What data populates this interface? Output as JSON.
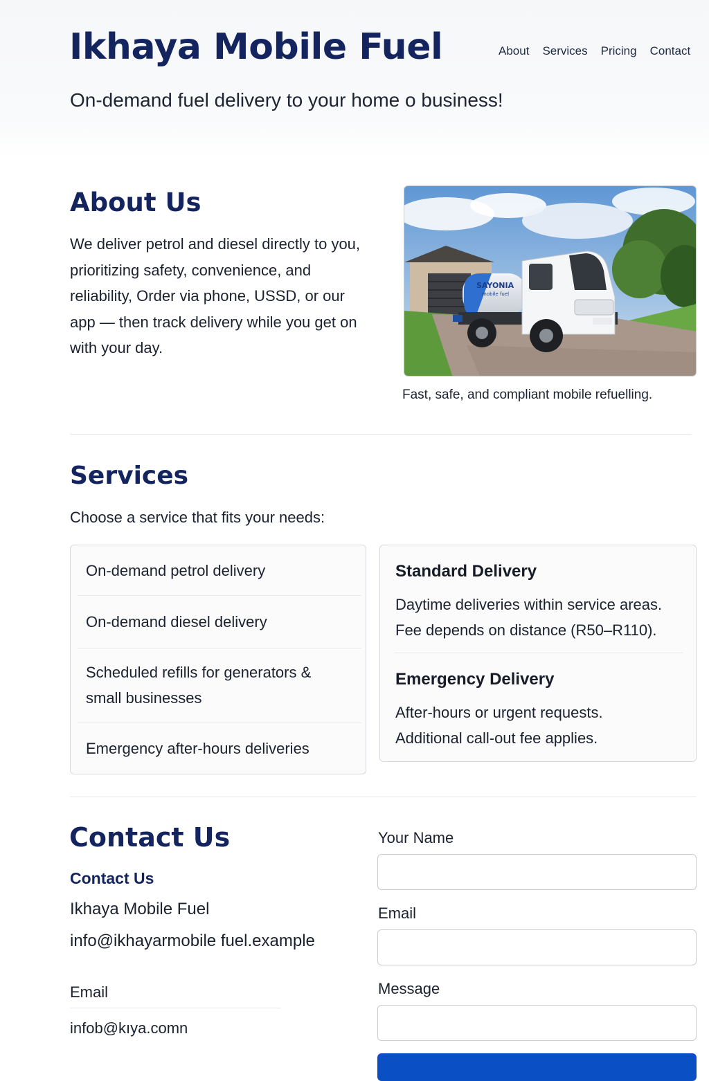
{
  "header": {
    "brand": "Ikhaya Mobile Fuel",
    "tagline": "On-demand fuel delivery to your home o business!",
    "nav": [
      "About",
      "Services",
      "Pricing",
      "Contact"
    ]
  },
  "about": {
    "heading": "About Us",
    "body": "We deliver petrol and diesel directly to you, prioritizing safety, convenience, and reliability, Order via phone, USSD, or our app — then track delivery while you get on with your day.",
    "caption": "Fast, safe, and compliant mobile refuelling.",
    "truck_tank_text": "SAYONIA",
    "truck_tank_subtext": "mobile fuel"
  },
  "services": {
    "heading": "Services",
    "intro": "Choose a service that fits your needs:",
    "items": [
      "On-demand petrol delivery",
      "On-demand diesel delivery",
      "Scheduled refills for generators & small businesses",
      "Emergency after-hours deliveries"
    ],
    "delivery_options": [
      {
        "title": "Standard Delivery",
        "lines": [
          "Daytime deliveries within service areas.",
          "Fee depends on distance (R50–R110)."
        ]
      },
      {
        "title": "Emergency Delivery",
        "lines": [
          "After-hours or urgent requests.",
          "Additional call-out fee applies."
        ]
      }
    ]
  },
  "contact": {
    "heading": "Contact Us",
    "subheading": "Contact Us",
    "company": "Ikhaya Mobile Fuel",
    "email_primary": "info@ikhayarmobile fuel.example",
    "email_label": "Email",
    "email_secondary": "infob@kıya.comn",
    "form": {
      "name_label": "Your Name",
      "email_label": "Email",
      "message_label": "Message"
    }
  },
  "colors": {
    "brand_navy": "#13245e",
    "accent_blue": "#0b4fc4",
    "header_bg": "#f6f7f9"
  }
}
